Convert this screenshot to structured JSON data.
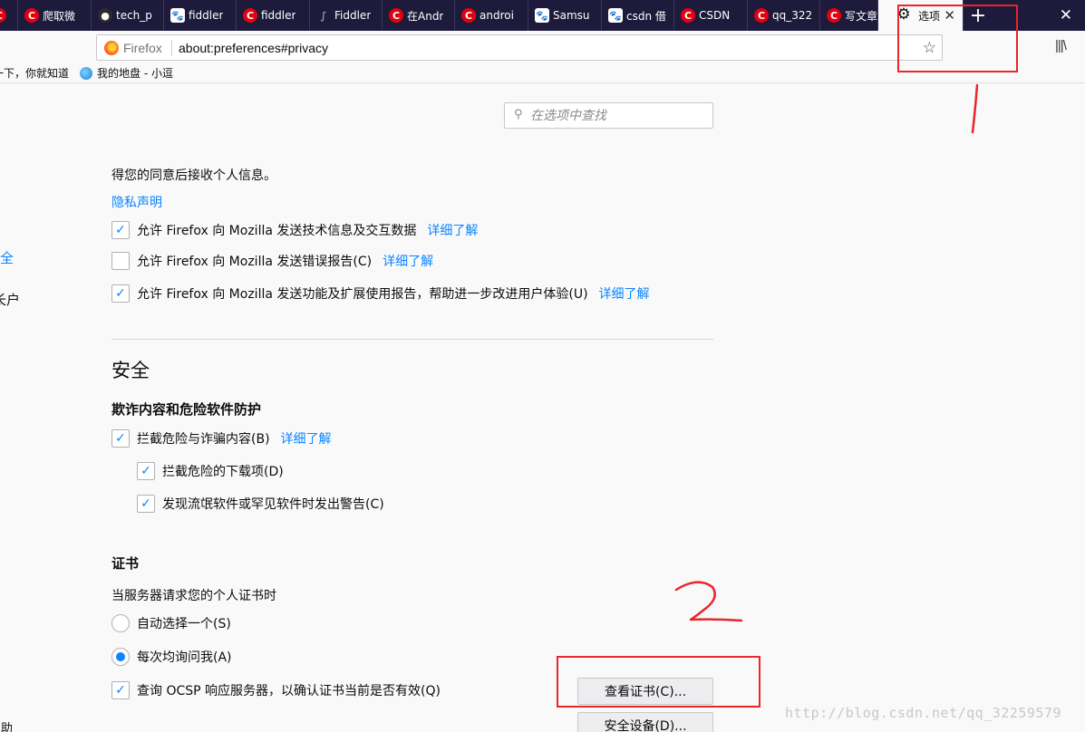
{
  "tabs": [
    {
      "label": "",
      "favicon": "csdn-icon",
      "width": 20
    },
    {
      "label": "爬取微",
      "favicon": "csdn-icon",
      "width": 81
    },
    {
      "label": "tech_p",
      "favicon": "github-icon",
      "width": 80
    },
    {
      "label": "fiddler",
      "favicon": "baidu-paw-icon",
      "width": 80
    },
    {
      "label": "fiddler",
      "favicon": "csdn-icon",
      "width": 81
    },
    {
      "label": "Fiddler",
      "favicon": "fiddler-icon",
      "width": 80
    },
    {
      "label": "在Andr",
      "favicon": "csdn-icon",
      "width": 80
    },
    {
      "label": "androi",
      "favicon": "csdn-icon",
      "width": 81
    },
    {
      "label": "Samsu",
      "favicon": "baidu-paw-icon",
      "width": 81
    },
    {
      "label": "csdn 借",
      "favicon": "baidu-paw-icon",
      "width": 80
    },
    {
      "label": "CSDN",
      "favicon": "csdn-icon",
      "width": 81
    },
    {
      "label": "qq_322",
      "favicon": "csdn-icon",
      "width": 80
    },
    {
      "label": "写文章",
      "favicon": "csdn-icon",
      "width": 64
    }
  ],
  "active_tab": {
    "label": "选项",
    "icon": "gear-icon"
  },
  "new_tab_symbol": "+",
  "window_close_symbol": "✕",
  "urlbar": {
    "identity": "Firefox",
    "url": "about:preferences#privacy"
  },
  "bookmarks": [
    {
      "label": "一下，你就知道",
      "icon": ""
    },
    {
      "label": "我的地盘 - 小逗",
      "icon": "globe-icon"
    }
  ],
  "sidebar_fragments": {
    "security": "全",
    "account": "长户",
    "help": "帮助"
  },
  "search": {
    "placeholder": "在选项中查找",
    "value": ""
  },
  "data_collection": {
    "consent_text": "得您的同意后接收个人信息。",
    "privacy_link": "隐私声明",
    "options": [
      {
        "label": "允许 Firefox 向 Mozilla 发送技术信息及交互数据",
        "checked": true,
        "learn_more": "详细了解"
      },
      {
        "label": "允许 Firefox 向 Mozilla 发送错误报告(C)",
        "checked": false,
        "learn_more": "详细了解"
      },
      {
        "label": "允许 Firefox 向 Mozilla 发送功能及扩展使用报告，帮助进一步改进用户体验(U)",
        "checked": true,
        "learn_more": "详细了解"
      }
    ]
  },
  "security": {
    "heading": "安全",
    "protection_heading": "欺诈内容和危险软件防护",
    "block_dangerous": {
      "label": "拦截危险与诈骗内容(B)",
      "checked": true,
      "learn_more": "详细了解"
    },
    "block_downloads": {
      "label": "拦截危险的下载项(D)",
      "checked": true
    },
    "warn_unwanted": {
      "label": "发现流氓软件或罕见软件时发出警告(C)",
      "checked": true
    }
  },
  "certificates": {
    "heading": "证书",
    "request_text": "当服务器请求您的个人证书时",
    "auto_select": {
      "label": "自动选择一个(S)",
      "selected": false
    },
    "ask_every_time": {
      "label": "每次均询问我(A)",
      "selected": true
    },
    "ocsp": {
      "label": "查询 OCSP 响应服务器，以确认证书当前是否有效(Q)",
      "checked": true
    },
    "view_certificates_button": "查看证书(C)...",
    "security_devices_button": "安全设备(D)..."
  },
  "watermark": "http://blog.csdn.net/qq_32259579",
  "annotation_color": "#e8262c"
}
